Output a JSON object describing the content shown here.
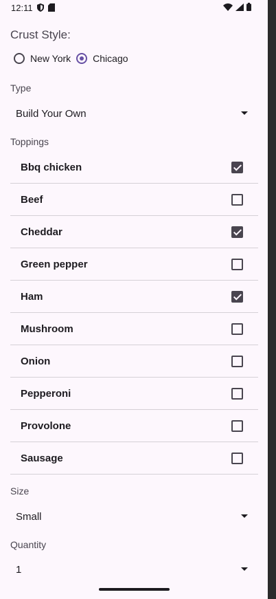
{
  "status_bar": {
    "time": "12:11"
  },
  "crust": {
    "title": "Crust Style:",
    "options": [
      {
        "label": "New York",
        "selected": false
      },
      {
        "label": "Chicago",
        "selected": true
      }
    ]
  },
  "type": {
    "label": "Type",
    "value": "Build Your Own"
  },
  "toppings": {
    "label": "Toppings",
    "items": [
      {
        "name": "Bbq chicken",
        "checked": true
      },
      {
        "name": "Beef",
        "checked": false
      },
      {
        "name": "Cheddar",
        "checked": true
      },
      {
        "name": "Green pepper",
        "checked": false
      },
      {
        "name": "Ham",
        "checked": true
      },
      {
        "name": "Mushroom",
        "checked": false
      },
      {
        "name": "Onion",
        "checked": false
      },
      {
        "name": "Pepperoni",
        "checked": false
      },
      {
        "name": "Provolone",
        "checked": false
      },
      {
        "name": "Sausage",
        "checked": false
      }
    ]
  },
  "size": {
    "label": "Size",
    "value": "Small"
  },
  "quantity": {
    "label": "Quantity",
    "value": "1"
  },
  "colors": {
    "accent": "#6750a4",
    "background": "#fdf7fd"
  }
}
